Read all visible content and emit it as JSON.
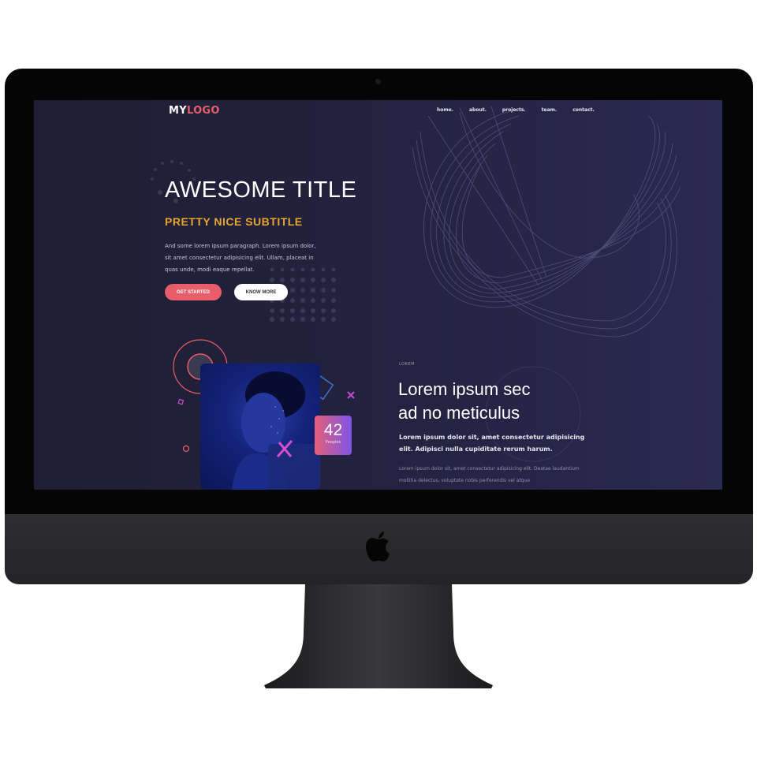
{
  "logo": {
    "part1": "MY",
    "part2": "LOGO"
  },
  "nav": [
    "home.",
    "about.",
    "projects.",
    "team.",
    "contact."
  ],
  "hero": {
    "title": "AWESOME TITLE",
    "subtitle": "PRETTY NICE SUBTITLE",
    "paragraph": "And some lorem ipsum paragraph. Lorem ipsum dolor, sit amet consectetur adipisicing elit. Ullam, placeat in quas unde, modi eaque repellat.",
    "primary_button": "GET STARTED",
    "secondary_button": "KNOW MORE"
  },
  "stat": {
    "value": "42",
    "label": "Peoples"
  },
  "section": {
    "label": "LOREM",
    "heading_line1": "Lorem ipsum sec",
    "heading_line2": "ad no meticulus",
    "lead": "Lorem ipsum dolor sit, amet consectetur adipisicing elit. Adipisci nulla cupiditate rerum harum.",
    "body": "Lorem ipsum dolor sit, amet consectetur adipisicing elit. Deatae laudantium mollitia delectus, voluptate nobis perferendis vel atque"
  },
  "colors": {
    "accent": "#e85d6a",
    "subtitle": "#e8a530",
    "bg": "#23223f"
  }
}
